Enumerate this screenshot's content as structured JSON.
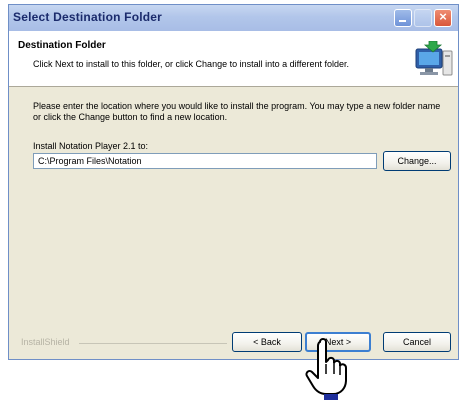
{
  "window": {
    "title": "Select Destination Folder"
  },
  "header": {
    "title": "Destination Folder",
    "description": "Click Next to install to this folder, or click Change to install into a different folder."
  },
  "body": {
    "instructions": "Please enter the location where you would like to install the program. You may type a new folder name or click the Change button to find a new location.",
    "install_label": "Install Notation Player 2.1 to:",
    "path_value": "C:\\Program Files\\Notation",
    "change_label": "Change..."
  },
  "footer": {
    "brand_text": "InstallShield",
    "back_label": "< Back",
    "next_label": "Next >",
    "cancel_label": "Cancel"
  },
  "colors": {
    "dialog_bg": "#ece9d8",
    "titlebar": "#b2c6ea",
    "close_button": "#d9573a"
  },
  "icons": [
    "minimize-icon",
    "maximize-icon",
    "close-icon",
    "computer-install-icon",
    "hand-pointer-icon"
  ]
}
